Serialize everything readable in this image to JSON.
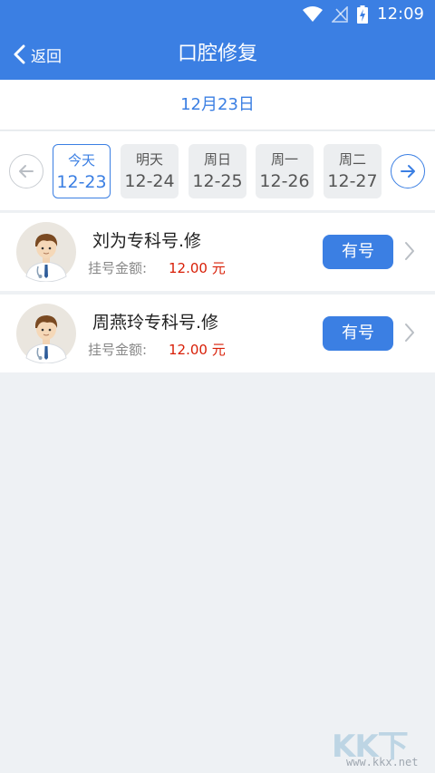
{
  "status_bar": {
    "time": "12:09"
  },
  "app_bar": {
    "back_label": "返回",
    "title": "口腔修复"
  },
  "selected_date": "12月23日",
  "days": [
    {
      "name": "今天",
      "date": "12-23",
      "active": true
    },
    {
      "name": "明天",
      "date": "12-24",
      "active": false
    },
    {
      "name": "周日",
      "date": "12-25",
      "active": false
    },
    {
      "name": "周一",
      "date": "12-26",
      "active": false
    },
    {
      "name": "周二",
      "date": "12-27",
      "active": false
    }
  ],
  "doctors": [
    {
      "name": "刘为专科号.修",
      "fee_label": "挂号金额:",
      "fee": "12.00 元",
      "status": "有号"
    },
    {
      "name": "周燕玲专科号.修",
      "fee_label": "挂号金额:",
      "fee": "12.00 元",
      "status": "有号"
    }
  ],
  "watermark": {
    "text": "KK下载",
    "url": "www.kkx.net"
  },
  "colors": {
    "primary": "#3b7fe3",
    "fee": "#d81e06",
    "background": "#eef1f4"
  },
  "icons": {
    "status": [
      "wifi-icon",
      "no-signal-icon",
      "battery-charging-icon"
    ],
    "back": "chevron-left-icon",
    "prev": "arrow-left-circle-icon",
    "next": "arrow-right-circle-icon",
    "row": "chevron-right-icon",
    "avatar": "doctor-avatar-icon"
  }
}
